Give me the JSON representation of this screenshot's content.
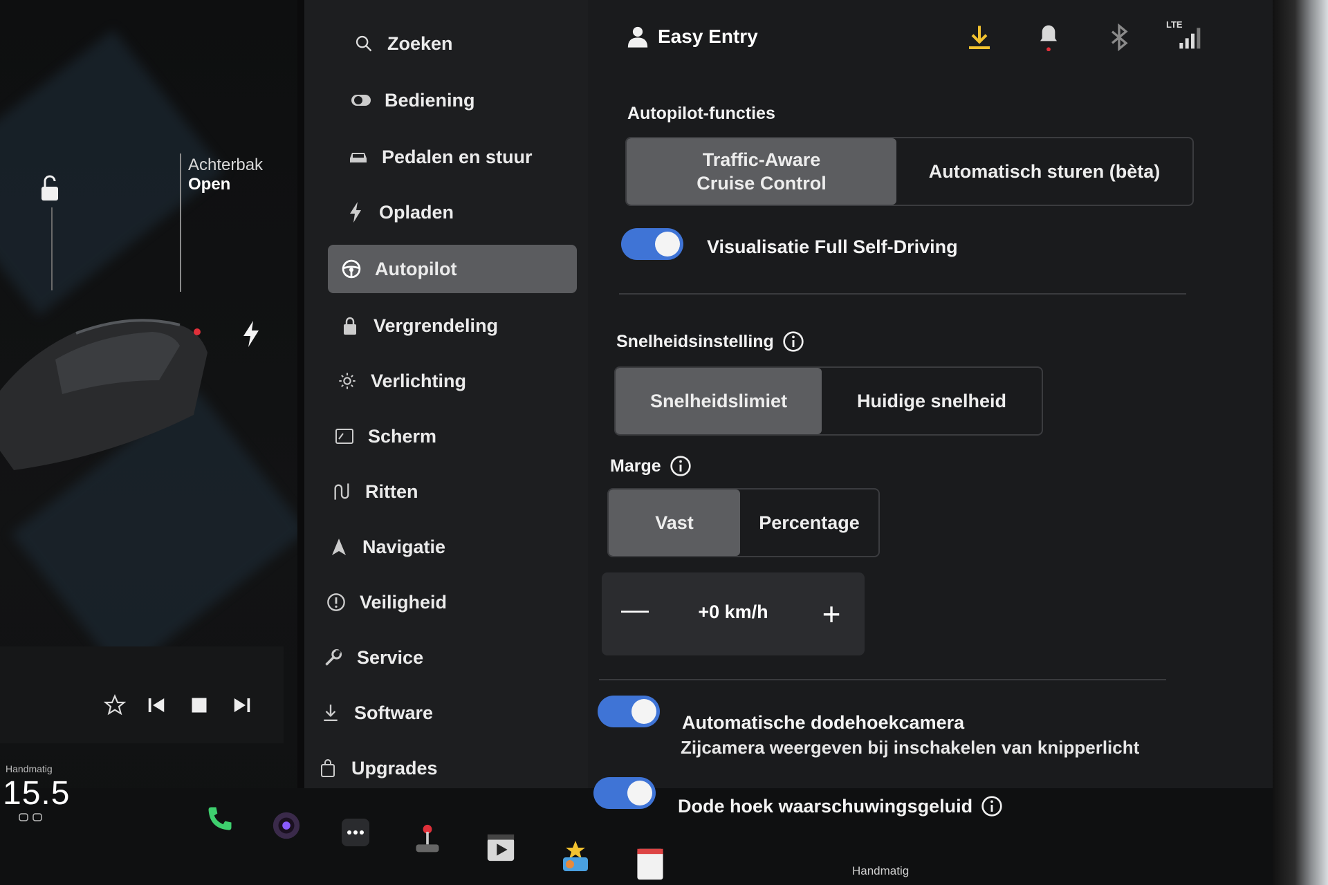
{
  "car_panel": {
    "trunk_label": "Achterbak",
    "trunk_status": "Open"
  },
  "cluster": {
    "drive_mode": "Handmatig",
    "odometer": "15.5"
  },
  "header": {
    "profile_name": "Easy Entry",
    "network": "LTE"
  },
  "menu": {
    "items": [
      {
        "label": "Zoeken",
        "icon": "search-icon"
      },
      {
        "label": "Bediening",
        "icon": "toggle-icon"
      },
      {
        "label": "Pedalen en stuur",
        "icon": "car-icon"
      },
      {
        "label": "Opladen",
        "icon": "bolt-icon"
      },
      {
        "label": "Autopilot",
        "icon": "steering-wheel-icon",
        "active": true
      },
      {
        "label": "Vergrendeling",
        "icon": "lock-icon"
      },
      {
        "label": "Verlichting",
        "icon": "sun-icon"
      },
      {
        "label": "Scherm",
        "icon": "screen-icon"
      },
      {
        "label": "Ritten",
        "icon": "trips-icon"
      },
      {
        "label": "Navigatie",
        "icon": "navigation-icon"
      },
      {
        "label": "Veiligheid",
        "icon": "safety-icon"
      },
      {
        "label": "Service",
        "icon": "wrench-icon"
      },
      {
        "label": "Software",
        "icon": "download-icon"
      },
      {
        "label": "Upgrades",
        "icon": "bag-icon"
      }
    ]
  },
  "autopilot": {
    "section_title": "Autopilot-functies",
    "features": {
      "option1": "Traffic-Aware Cruise Control",
      "option1_line1": "Traffic-Aware",
      "option1_line2": "Cruise Control",
      "option2": "Automatisch sturen (bèta)"
    },
    "fsd_visualization": {
      "label": "Visualisatie Full Self-Driving",
      "enabled": true
    },
    "speed_setting": {
      "title": "Snelheidsinstelling",
      "option1": "Snelheidslimiet",
      "option2": "Huidige snelheid",
      "selected": "Snelheidslimiet"
    },
    "margin": {
      "title": "Marge",
      "option1": "Vast",
      "option2": "Percentage",
      "selected": "Vast",
      "value": "+0 km/h"
    },
    "blind_spot_camera": {
      "label": "Automatische dodehoekcamera",
      "sub": "Zijcamera weergeven bij inschakelen van knipperlicht",
      "enabled": true
    },
    "blind_spot_chime": {
      "label": "Dode hoek waarschuwingsgeluid",
      "enabled": true
    }
  },
  "dock": {
    "label": "Handmatig",
    "icons": [
      "phone-icon",
      "camera-icon",
      "more-icon",
      "joystick-icon",
      "video-icon",
      "toybox-icon",
      "notes-icon"
    ]
  },
  "colors": {
    "accent_blue": "#3f74d6",
    "download_yellow": "#f2c230",
    "phone_green": "#3ecf6e",
    "alert_red": "#e0303a"
  }
}
